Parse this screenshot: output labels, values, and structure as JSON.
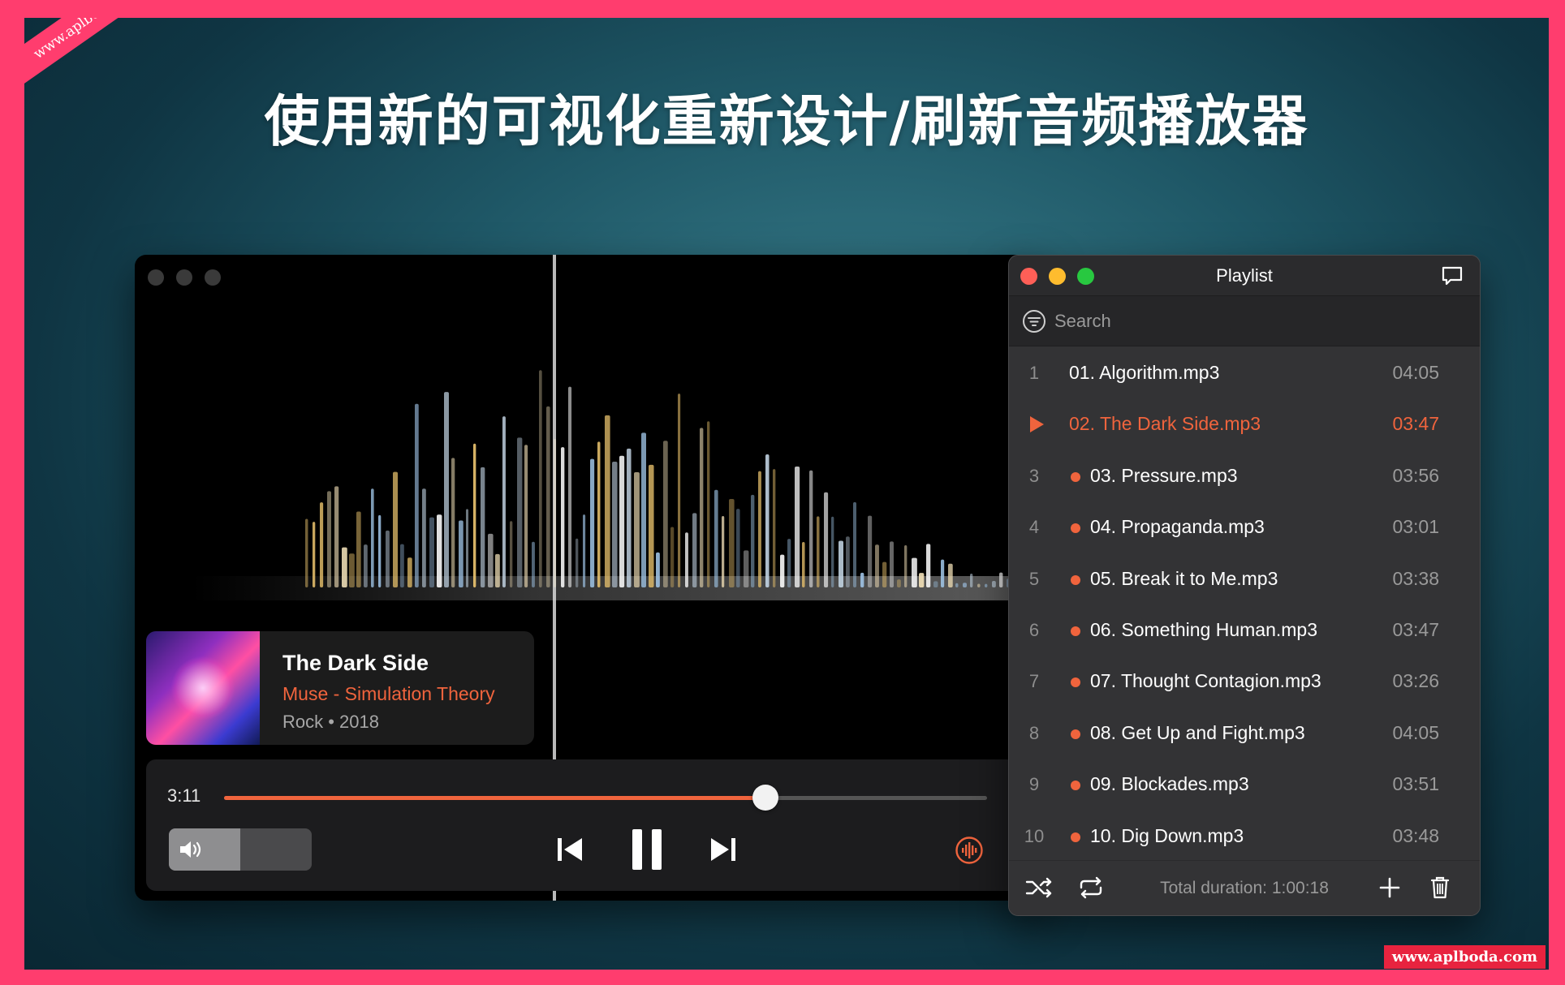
{
  "headline": "使用新的可视化重新设计/刷新音频播放器",
  "watermark": {
    "ribbon": "www.aplboda.com",
    "corner": "www.aplboda.com"
  },
  "now_playing": {
    "title": "The Dark Side",
    "artist_album": "Muse - Simulation Theory",
    "genre_year": "Rock • 2018",
    "elapsed": "3:11",
    "progress_fraction": 0.71,
    "volume_fraction": 0.5
  },
  "playlist": {
    "title": "Playlist",
    "search_placeholder": "Search",
    "tracks": [
      {
        "num": "1",
        "name": "01. Algorithm.mp3",
        "duration": "04:05",
        "state": "plain"
      },
      {
        "num": "",
        "name": "02. The Dark Side.mp3",
        "duration": "03:47",
        "state": "playing"
      },
      {
        "num": "3",
        "name": "03. Pressure.mp3",
        "duration": "03:56",
        "state": "dot"
      },
      {
        "num": "4",
        "name": "04. Propaganda.mp3",
        "duration": "03:01",
        "state": "dot"
      },
      {
        "num": "5",
        "name": "05. Break it to Me.mp3",
        "duration": "03:38",
        "state": "dot"
      },
      {
        "num": "6",
        "name": "06. Something Human.mp3",
        "duration": "03:47",
        "state": "dot"
      },
      {
        "num": "7",
        "name": "07. Thought Contagion.mp3",
        "duration": "03:26",
        "state": "dot"
      },
      {
        "num": "8",
        "name": "08. Get Up and Fight.mp3",
        "duration": "04:05",
        "state": "dot"
      },
      {
        "num": "9",
        "name": "09. Blockades.mp3",
        "duration": "03:51",
        "state": "dot"
      },
      {
        "num": "10",
        "name": "10. Dig Down.mp3",
        "duration": "03:48",
        "state": "dot"
      }
    ],
    "total_duration": "Total duration: 1:00:18"
  },
  "colors": {
    "accent": "#f0643d",
    "close": "#fe5f57",
    "minimize": "#febc2e",
    "zoom": "#28c840"
  },
  "icons": [
    "volume-icon",
    "previous-icon",
    "pause-icon",
    "next-icon",
    "visualizer-icon",
    "chat-icon",
    "filter-icon",
    "play-icon",
    "shuffle-icon",
    "repeat-icon",
    "add-icon",
    "trash-icon"
  ]
}
